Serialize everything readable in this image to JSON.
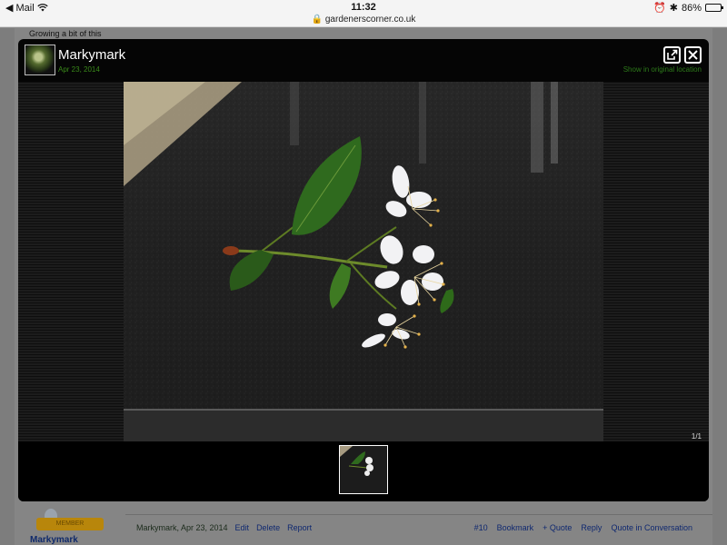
{
  "statusbar": {
    "back_app": "Mail",
    "time": "11:32",
    "url": "gardenerscorner.co.uk",
    "battery_text": "86%",
    "battery_level": 0.86
  },
  "page": {
    "snippet": "Growing a bit of this",
    "poster_name": "Markymark",
    "badge_text": "MEMBER",
    "footer": {
      "meta": "Markymark, Apr 23, 2014",
      "actions_left": [
        "Edit",
        "Delete",
        "Report"
      ],
      "post_number": "#10",
      "actions_right": [
        "Bookmark",
        "+ Quote",
        "Reply",
        "Quote in Conversation"
      ]
    }
  },
  "lightbox": {
    "username": "Markymark",
    "date": "Apr 23, 2014",
    "show_original": "Show in original location",
    "counter": "1/1",
    "icons": {
      "external": "external-link-icon",
      "close": "close-icon"
    },
    "photo_subject": "cherry-blossom-sprig"
  },
  "colors": {
    "lightbox_bg": "#050505",
    "date_green": "#3a8a1a",
    "link_blue": "#0f2870"
  }
}
